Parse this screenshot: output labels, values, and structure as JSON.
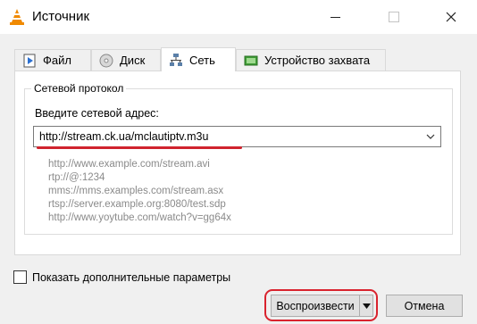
{
  "window": {
    "title": "Источник",
    "app_icon": "vlc-cone-icon",
    "controls": {
      "minimize": "minimize-icon",
      "maximize": "maximize-icon",
      "close": "close-icon"
    }
  },
  "tabs": [
    {
      "label": "Файл",
      "icon": "file-icon",
      "active": false
    },
    {
      "label": "Диск",
      "icon": "disc-icon",
      "active": false
    },
    {
      "label": "Сеть",
      "icon": "network-icon",
      "active": true
    },
    {
      "label": "Устройство захвата",
      "icon": "capture-device-icon",
      "active": false
    }
  ],
  "network": {
    "group_title": "Сетевой протокол",
    "address_label": "Введите сетевой адрес:",
    "address_value": "http://stream.ck.ua/mclautiptv.m3u",
    "examples": [
      "http://www.example.com/stream.avi",
      "rtp://@:1234",
      "mms://mms.examples.com/stream.asx",
      "rtsp://server.example.org:8080/test.sdp",
      "http://www.yoytube.com/watch?v=gg64x"
    ]
  },
  "options": {
    "show_more_label": "Показать дополнительные параметры",
    "checked": false
  },
  "buttons": {
    "play_label": "Воспроизвести",
    "cancel_label": "Отмена"
  },
  "colors": {
    "highlight": "#d0232e",
    "vlc_orange": "#f08a00"
  }
}
